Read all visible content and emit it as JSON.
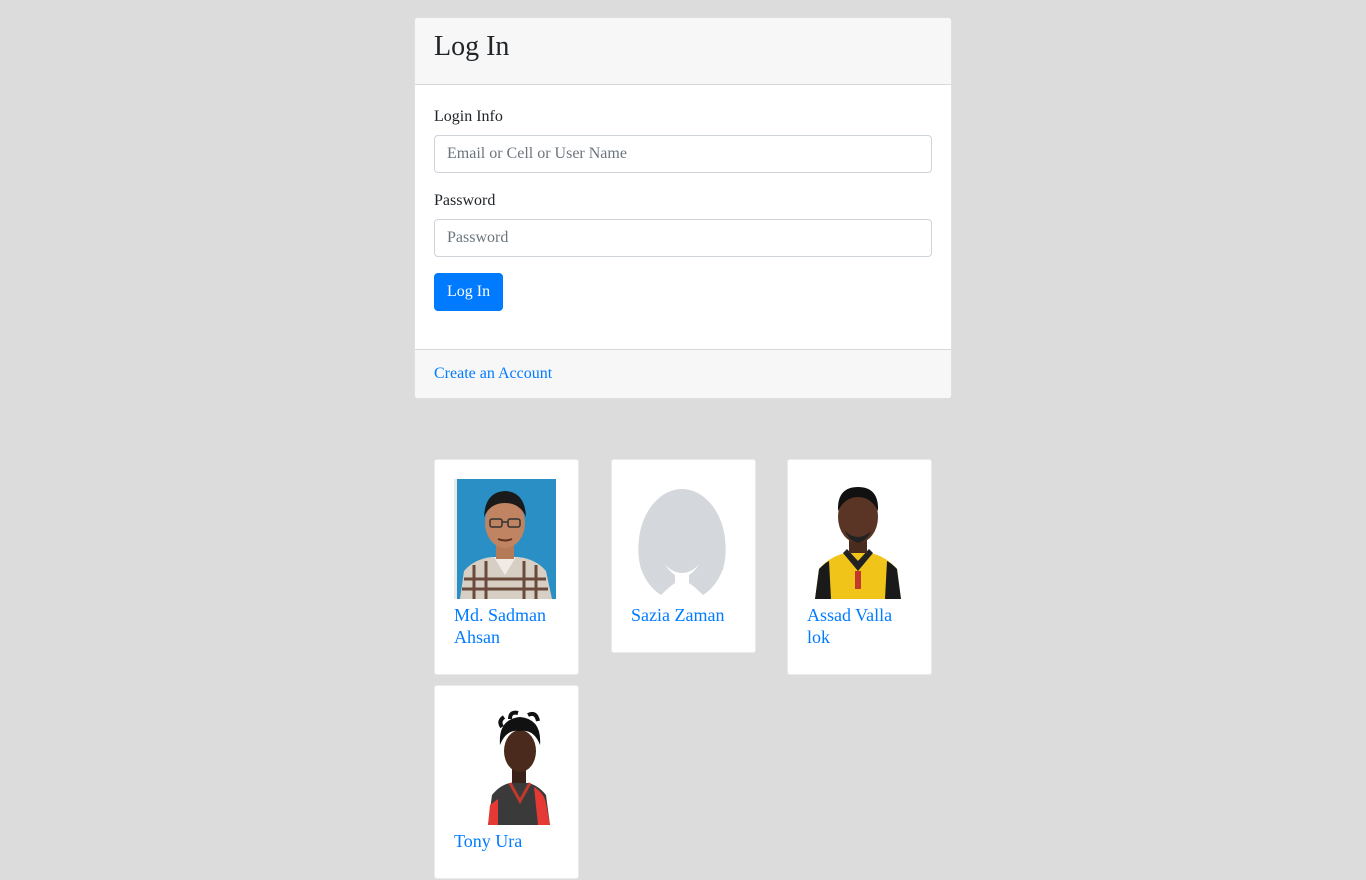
{
  "login_card": {
    "title": "Log In",
    "login_info_label": "Login Info",
    "login_info_placeholder": "Email or Cell or User Name",
    "password_label": "Password",
    "password_placeholder": "Password",
    "submit_label": "Log In",
    "create_account_label": "Create an Account"
  },
  "users": [
    {
      "name": "Md. Sadman Ahsan",
      "photo": "student-portrait-blue-background"
    },
    {
      "name": "Sazia Zaman",
      "photo": "default-avatar-silhouette"
    },
    {
      "name": "Assad Valla lok",
      "photo": "cricketer-yellow-jersey"
    },
    {
      "name": "Tony Ura",
      "photo": "cricketer-red-black-jersey"
    }
  ],
  "colors": {
    "page_background": "#dcdcdc",
    "primary": "#007bff",
    "card_header": "#f7f7f7"
  }
}
